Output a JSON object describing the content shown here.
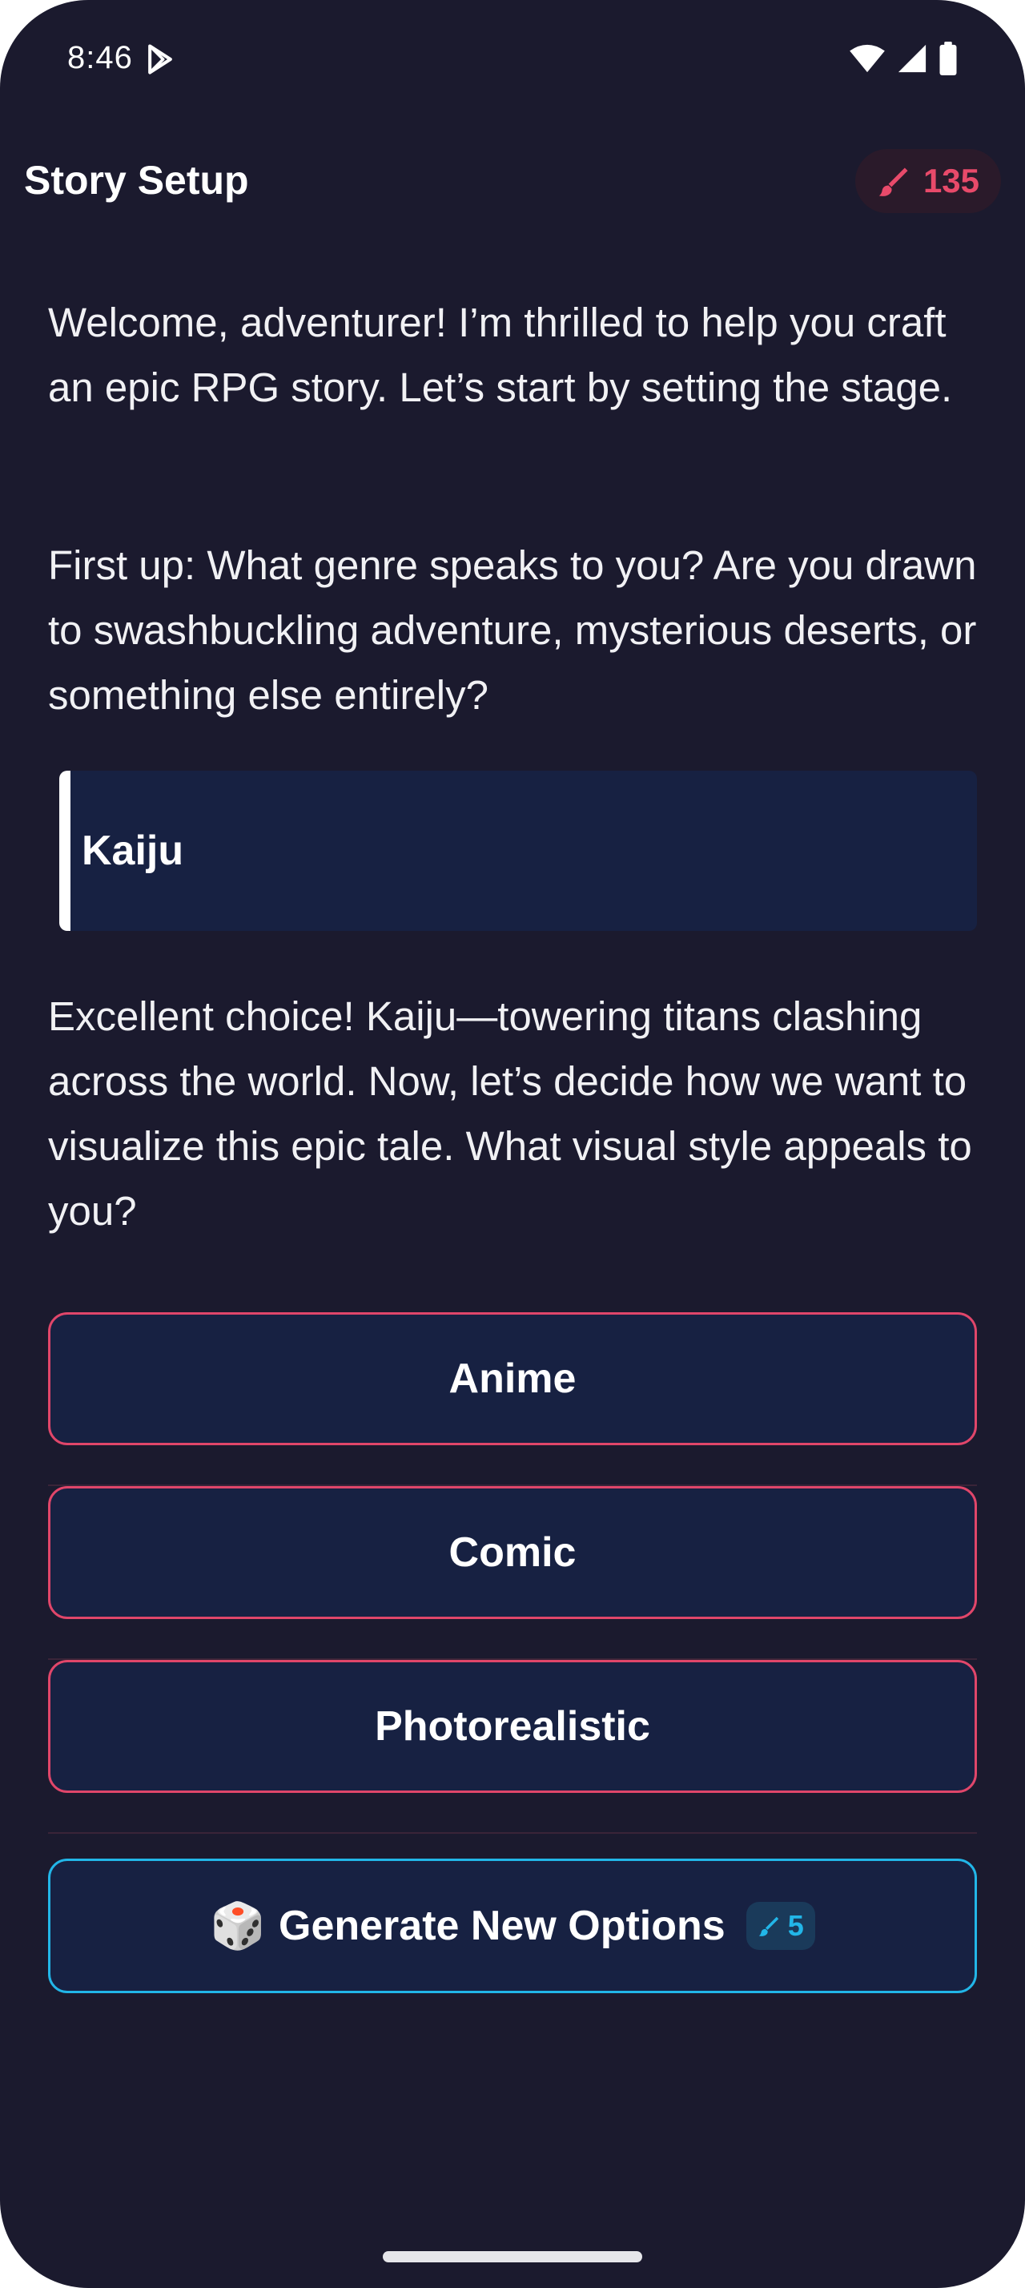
{
  "status_bar": {
    "time": "8:46"
  },
  "header": {
    "title": "Story Setup",
    "credits": "135"
  },
  "chat": {
    "msg1": "Welcome, adventurer! I’m thrilled to help you craft an epic RPG story. Let’s start by setting the stage.",
    "msg2": "First up: What genre speaks to you? Are you drawn to swashbuckling adventure, mysterious deserts, or something else entirely?",
    "user_reply": "Kaiju",
    "msg3": "Excellent choice! Kaiju—towering titans clashing across the world. Now, let’s decide how we want to visualize this epic tale. What visual style appeals to you?"
  },
  "options": [
    {
      "label": "Anime"
    },
    {
      "label": "Comic"
    },
    {
      "label": "Photorealistic"
    }
  ],
  "generate": {
    "label": "Generate New Options",
    "cost": "5"
  },
  "colors": {
    "background": "#1b1a2e",
    "option_border": "#e0466a",
    "generate_border": "#22b6e8",
    "card_fill": "#172142"
  },
  "icons": {
    "status_left": "play-store-icon",
    "status_right": [
      "wifi-icon",
      "signal-icon",
      "battery-icon"
    ],
    "credits": "brush-icon",
    "generate": "dice-icon"
  }
}
